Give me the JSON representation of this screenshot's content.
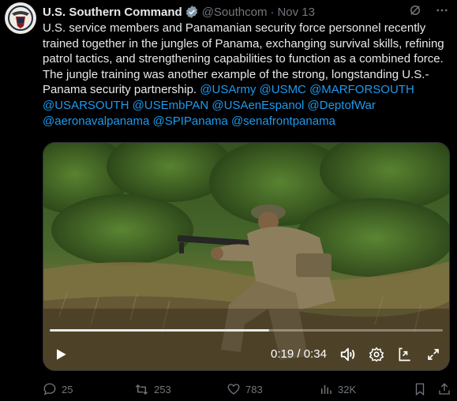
{
  "author": {
    "name": "U.S. Southern Command",
    "handle": "@Southcom",
    "separator": "·",
    "date": "Nov 13"
  },
  "tweet": {
    "text": "U.S. service members and Panamanian security force personnel recently trained together in the jungles of Panama, exchanging survival skills, refining patrol tactics, and strengthening capabilities to function as a combined force. The jungle training was another example of the strong, longstanding U.S.-Panama security partnership.",
    "mentions": [
      "@USArmy",
      "@USMC",
      "@MARFORSOUTH",
      "@USARSOUTH",
      "@USEmbPAN",
      "@USAenEspanol",
      "@DeptofWar",
      "@aeronavalpanama",
      "@SPIPanama",
      "@senafrontpanama"
    ]
  },
  "video": {
    "time_current": "0:19",
    "time_separator": " / ",
    "time_total": "0:34",
    "progress_fraction": 0.559
  },
  "actions": {
    "replies": "25",
    "reposts": "253",
    "likes": "783",
    "views": "32K"
  },
  "colors": {
    "background": "#000000",
    "text": "#e7e9ea",
    "muted": "#71767b",
    "link": "#1d9bf0"
  },
  "icons": [
    "verified-badge-icon",
    "grok-icon",
    "more-icon",
    "play-icon",
    "volume-icon",
    "settings-gear-icon",
    "pip-icon",
    "fullscreen-icon",
    "reply-icon",
    "repost-icon",
    "like-icon",
    "views-icon",
    "bookmark-icon",
    "share-icon"
  ]
}
